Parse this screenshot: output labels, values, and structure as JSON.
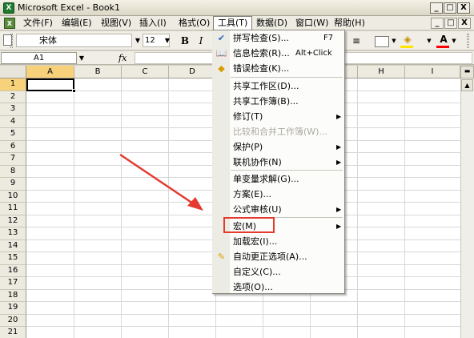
{
  "window": {
    "app_icon": "excel-icon",
    "title": "Microsoft Excel - Book1",
    "min_label": "_",
    "max_label": "□",
    "close_label": "X"
  },
  "menubar": {
    "doc_icon": "document-icon",
    "items": [
      "文件(F)",
      "编辑(E)",
      "视图(V)",
      "插入(I)",
      "格式(O)",
      "工具(T)",
      "数据(D)",
      "窗口(W)",
      "帮助(H)"
    ],
    "doc_min": "_",
    "doc_restore": "□",
    "doc_close": "X"
  },
  "toolbar": {
    "font_name": "宋体",
    "font_size": "12",
    "bold": "B",
    "italic": "I",
    "font_color_letter": "A",
    "fill_color": "#ffe400",
    "font_color": "#ff0000"
  },
  "formulabar": {
    "namebox": "A1",
    "fx": "fx",
    "content": ""
  },
  "sheet": {
    "columns": [
      "A",
      "B",
      "C",
      "D",
      "E",
      "F",
      "G",
      "H",
      "I"
    ],
    "rows": [
      "1",
      "2",
      "3",
      "4",
      "5",
      "6",
      "7",
      "8",
      "9",
      "10",
      "11",
      "12",
      "13",
      "14",
      "15",
      "16",
      "17",
      "18",
      "19",
      "20",
      "21"
    ],
    "active_cell": "A1"
  },
  "tools_menu": {
    "items": [
      {
        "label": "拼写检查(S)...",
        "shortcut": "F7",
        "icon": "spelling-icon"
      },
      {
        "label": "信息检索(R)...",
        "shortcut": "Alt+Click",
        "icon": "research-icon"
      },
      {
        "label": "错误检查(K)...",
        "icon": "error-check-icon"
      },
      {
        "label": "共享工作区(D)..."
      },
      {
        "label": "共享工作簿(B)..."
      },
      {
        "label": "修订(T)",
        "submenu": true
      },
      {
        "label": "比较和合并工作簿(W)...",
        "disabled": true
      },
      {
        "label": "保护(P)",
        "submenu": true
      },
      {
        "label": "联机协作(N)",
        "submenu": true
      },
      {
        "label": "单变量求解(G)..."
      },
      {
        "label": "方案(E)..."
      },
      {
        "label": "公式审核(U)",
        "submenu": true
      },
      {
        "label": "宏(M)",
        "submenu": true,
        "highlighted": true
      },
      {
        "label": "加载宏(I)..."
      },
      {
        "label": "自动更正选项(A)...",
        "icon": "autocorrect-icon"
      },
      {
        "label": "自定义(C)..."
      },
      {
        "label": "选项(O)..."
      }
    ]
  },
  "annotation": {
    "highlight_color": "#e53a2f"
  }
}
